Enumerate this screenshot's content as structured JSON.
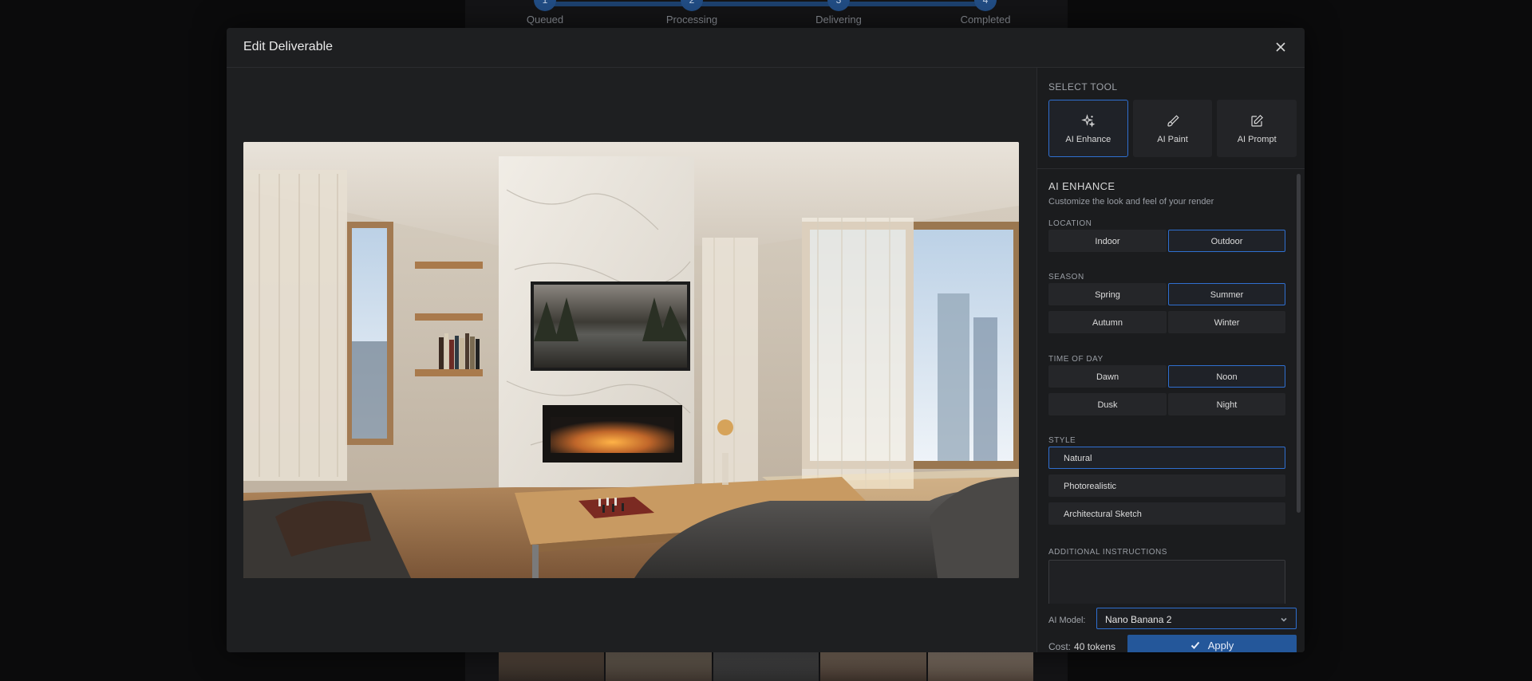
{
  "stepper": {
    "steps": [
      {
        "num": "1",
        "label": "Queued"
      },
      {
        "num": "2",
        "label": "Processing"
      },
      {
        "num": "3",
        "label": "Delivering"
      },
      {
        "num": "4",
        "label": "Completed"
      }
    ]
  },
  "modal": {
    "title": "Edit Deliverable",
    "close_icon": "close-icon"
  },
  "panel": {
    "select_tool_label": "SELECT TOOL",
    "tools": [
      {
        "label": "AI Enhance",
        "icon": "sparkles-icon",
        "active": true
      },
      {
        "label": "AI Paint",
        "icon": "brush-icon",
        "active": false
      },
      {
        "label": "AI Prompt",
        "icon": "edit-icon",
        "active": false
      }
    ],
    "enhance": {
      "title": "AI ENHANCE",
      "subtitle": "Customize the look and feel of your render",
      "location": {
        "label": "LOCATION",
        "options": [
          "Indoor",
          "Outdoor"
        ],
        "selected": "Outdoor"
      },
      "season": {
        "label": "SEASON",
        "options": [
          "Spring",
          "Summer",
          "Autumn",
          "Winter"
        ],
        "selected": "Summer"
      },
      "time_of_day": {
        "label": "TIME OF DAY",
        "options": [
          "Dawn",
          "Noon",
          "Dusk",
          "Night"
        ],
        "selected": "Noon"
      },
      "style": {
        "label": "STYLE",
        "options": [
          "Natural",
          "Photorealistic",
          "Architectural Sketch"
        ],
        "selected": "Natural"
      },
      "additional_label": "ADDITIONAL INSTRUCTIONS"
    },
    "footer": {
      "model_label": "AI Model:",
      "model_value": "Nano Banana 2",
      "cost_label": "Cost:",
      "cost_value": "40 tokens",
      "apply_label": "Apply"
    }
  },
  "colors": {
    "accent": "#2f6fd0",
    "apply": "#24579a"
  }
}
